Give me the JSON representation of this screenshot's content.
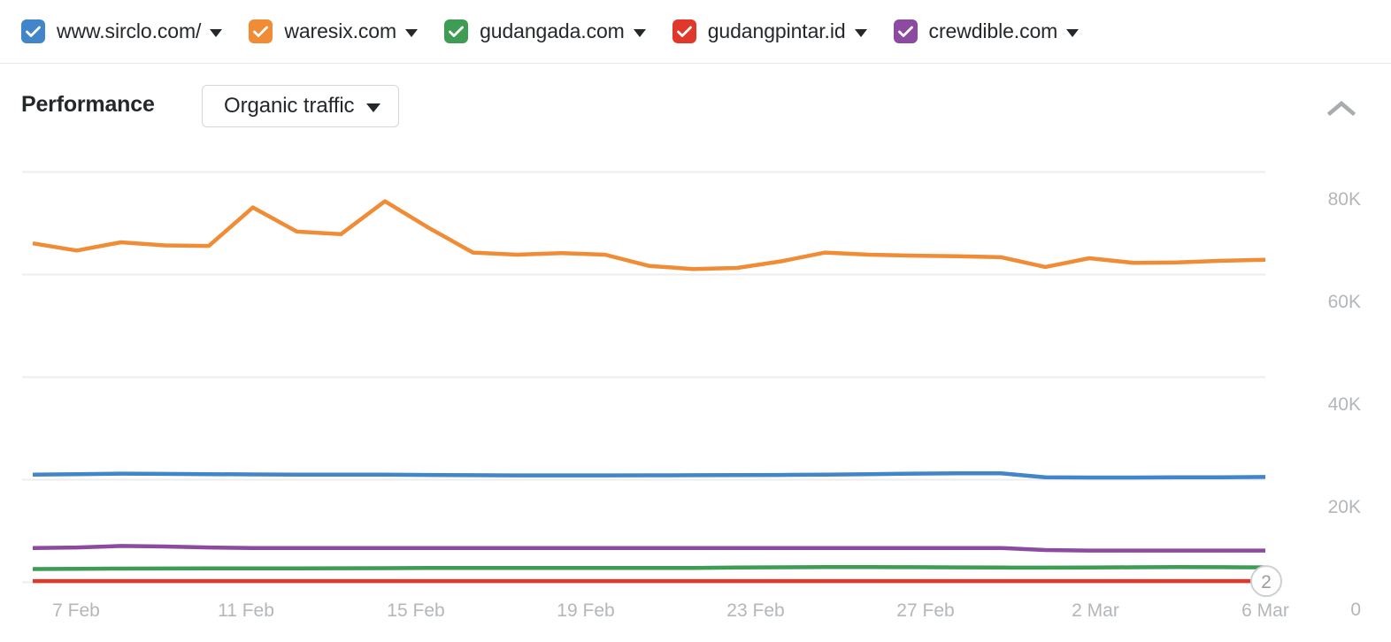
{
  "legend": {
    "items": [
      {
        "label": "www.sirclo.com/",
        "color": "#4285c8",
        "checked": true,
        "icon": "checkbox-checked-icon"
      },
      {
        "label": "waresix.com",
        "color": "#ef8c35",
        "checked": true,
        "icon": "checkbox-checked-icon"
      },
      {
        "label": "gudangada.com",
        "color": "#3e9c54",
        "checked": true,
        "icon": "checkbox-checked-icon"
      },
      {
        "label": "gudangpintar.id",
        "color": "#e0392c",
        "checked": true,
        "icon": "checkbox-checked-icon"
      },
      {
        "label": "crewdible.com",
        "color": "#8c4ba0",
        "checked": true,
        "icon": "checkbox-checked-icon"
      }
    ],
    "dropdown_icon": "chevron-down-icon"
  },
  "header": {
    "title": "Performance",
    "metric": "Organic traffic",
    "metric_caret_icon": "chevron-down-icon",
    "collapse_icon": "chevron-up-icon"
  },
  "chart_data": {
    "type": "line",
    "title": "Performance",
    "subtitle": "Organic traffic",
    "xlabel": "",
    "ylabel": "",
    "grid": true,
    "legend_position": "top",
    "ylim": [
      0,
      90000
    ],
    "yticks": [
      0,
      20000,
      40000,
      60000,
      80000
    ],
    "ytick_labels": [
      "0",
      "20K",
      "40K",
      "60K",
      "80K"
    ],
    "xtick_labels": [
      "7 Feb",
      "11 Feb",
      "15 Feb",
      "19 Feb",
      "23 Feb",
      "27 Feb",
      "2 Mar",
      "6 Mar"
    ],
    "x": [
      "6 Feb",
      "7 Feb",
      "8 Feb",
      "9 Feb",
      "10 Feb",
      "11 Feb",
      "12 Feb",
      "13 Feb",
      "14 Feb",
      "15 Feb",
      "16 Feb",
      "17 Feb",
      "18 Feb",
      "19 Feb",
      "20 Feb",
      "21 Feb",
      "22 Feb",
      "23 Feb",
      "24 Feb",
      "25 Feb",
      "26 Feb",
      "27 Feb",
      "28 Feb",
      "1 Mar",
      "2 Mar",
      "3 Mar",
      "4 Mar",
      "5 Mar",
      "6 Mar"
    ],
    "end_marker": {
      "label": "2",
      "series": "gudangpintar.id"
    },
    "series": [
      {
        "name": "waresix.com",
        "color": "#ef8c35",
        "values": [
          66000,
          64600,
          66200,
          65600,
          65500,
          73000,
          68300,
          67800,
          74200,
          69000,
          64200,
          63800,
          64100,
          63800,
          61600,
          61000,
          61200,
          62500,
          64200,
          63800,
          63600,
          63500,
          63300,
          61400,
          63100,
          62200,
          62300,
          62600,
          62800
        ]
      },
      {
        "name": "www.sirclo.com/",
        "color": "#4285c8",
        "values": [
          20900,
          21000,
          21100,
          21050,
          21000,
          20950,
          20900,
          20900,
          20900,
          20850,
          20800,
          20750,
          20750,
          20750,
          20780,
          20800,
          20820,
          20850,
          20900,
          21000,
          21100,
          21150,
          21150,
          20400,
          20350,
          20350,
          20380,
          20400,
          20450
        ]
      },
      {
        "name": "crewdible.com",
        "color": "#8c4ba0",
        "values": [
          6600,
          6700,
          7000,
          6900,
          6700,
          6600,
          6600,
          6600,
          6600,
          6600,
          6600,
          6600,
          6600,
          6600,
          6600,
          6600,
          6600,
          6600,
          6600,
          6600,
          6600,
          6600,
          6600,
          6200,
          6100,
          6100,
          6100,
          6100,
          6100
        ]
      },
      {
        "name": "gudangada.com",
        "color": "#3e9c54",
        "values": [
          2500,
          2550,
          2580,
          2600,
          2620,
          2630,
          2640,
          2650,
          2680,
          2700,
          2700,
          2700,
          2700,
          2700,
          2700,
          2720,
          2800,
          2850,
          2900,
          2900,
          2870,
          2830,
          2800,
          2780,
          2800,
          2850,
          2880,
          2860,
          2820
        ]
      },
      {
        "name": "gudangpintar.id",
        "color": "#e0392c",
        "values": [
          150,
          150,
          150,
          150,
          150,
          150,
          150,
          150,
          150,
          150,
          150,
          150,
          150,
          150,
          150,
          150,
          150,
          150,
          150,
          150,
          150,
          150,
          150,
          150,
          150,
          150,
          150,
          150,
          150
        ]
      }
    ]
  }
}
